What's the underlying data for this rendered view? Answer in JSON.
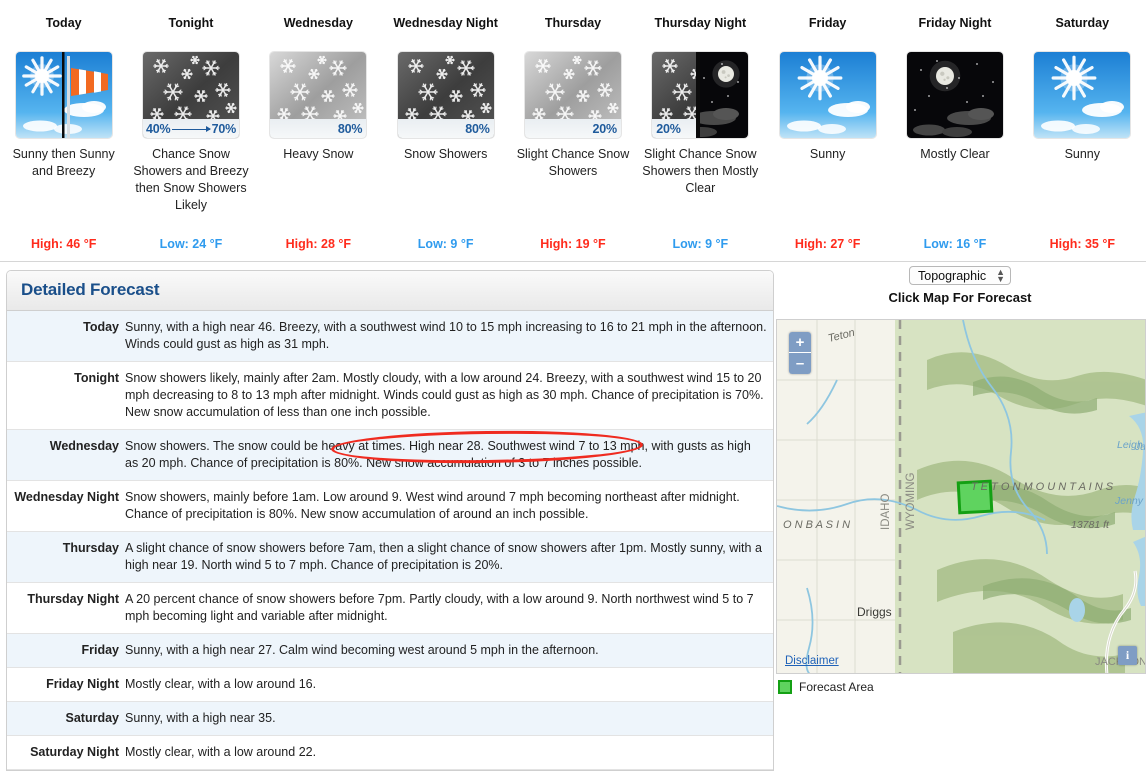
{
  "forecast_periods": [
    {
      "name": "Today",
      "icon": "sunny-windy-icon",
      "short_desc": "Sunny then Sunny and Breezy",
      "temp_type": "High",
      "temp_label": "High: 46 °F",
      "pop": null
    },
    {
      "name": "Tonight",
      "icon": "snow-chance-icon",
      "short_desc": "Chance Snow Showers and Breezy then Snow Showers Likely",
      "temp_type": "Low",
      "temp_label": "Low: 24 °F",
      "pop": "40% ⟶ 70%",
      "pop_start": "40%",
      "pop_end": "70%"
    },
    {
      "name": "Wednesday",
      "icon": "heavy-snow-icon",
      "short_desc": "Heavy Snow",
      "temp_type": "High",
      "temp_label": "High: 28 °F",
      "pop": "80%"
    },
    {
      "name": "Wednesday Night",
      "icon": "snow-showers-icon",
      "short_desc": "Snow Showers",
      "temp_type": "Low",
      "temp_label": "Low: 9 °F",
      "pop": "80%"
    },
    {
      "name": "Thursday",
      "icon": "slight-chance-snow-icon",
      "short_desc": "Slight Chance Snow Showers",
      "temp_type": "High",
      "temp_label": "High: 19 °F",
      "pop": "20%"
    },
    {
      "name": "Thursday Night",
      "icon": "snow-then-clear-night-icon",
      "short_desc": "Slight Chance Snow Showers then Mostly Clear",
      "temp_type": "Low",
      "temp_label": "Low: 9 °F",
      "pop": "20%"
    },
    {
      "name": "Friday",
      "icon": "sunny-icon",
      "short_desc": "Sunny",
      "temp_type": "High",
      "temp_label": "High: 27 °F",
      "pop": null
    },
    {
      "name": "Friday Night",
      "icon": "mostly-clear-night-icon",
      "short_desc": "Mostly Clear",
      "temp_type": "Low",
      "temp_label": "Low: 16 °F",
      "pop": null
    },
    {
      "name": "Saturday",
      "icon": "sunny-icon",
      "short_desc": "Sunny",
      "temp_type": "High",
      "temp_label": "High: 35 °F",
      "pop": null
    }
  ],
  "detailed_forecast": {
    "title": "Detailed Forecast",
    "rows": [
      {
        "label": "Today",
        "text": "Sunny, with a high near 46. Breezy, with a southwest wind 10 to 15 mph increasing to 16 to 21 mph in the afternoon. Winds could gust as high as 31 mph."
      },
      {
        "label": "Tonight",
        "text": "Snow showers likely, mainly after 2am. Mostly cloudy, with a low around 24. Breezy, with a southwest wind 15 to 20 mph decreasing to 8 to 13 mph after midnight. Winds could gust as high as 30 mph. Chance of precipitation is 70%. New snow accumulation of less than one inch possible."
      },
      {
        "label": "Wednesday",
        "text": "Snow showers. The snow could be heavy at times. High near 28. Southwest wind 7 to 13 mph, with gusts as high as 20 mph. Chance of precipitation is 80%. New snow accumulation of 3 to 7 inches possible."
      },
      {
        "label": "Wednesday Night",
        "text": "Snow showers, mainly before 1am. Low around 9. West wind around 7 mph becoming northeast after midnight. Chance of precipitation is 80%. New snow accumulation of around an inch possible."
      },
      {
        "label": "Thursday",
        "text": "A slight chance of snow showers before 7am, then a slight chance of snow showers after 1pm. Mostly sunny, with a high near 19. North wind 5 to 7 mph. Chance of precipitation is 20%."
      },
      {
        "label": "Thursday Night",
        "text": "A 20 percent chance of snow showers before 7pm. Partly cloudy, with a low around 9. North northwest wind 5 to 7 mph becoming light and variable after midnight."
      },
      {
        "label": "Friday",
        "text": "Sunny, with a high near 27. Calm wind becoming west around 5 mph in the afternoon."
      },
      {
        "label": "Friday Night",
        "text": "Mostly clear, with a low around 16."
      },
      {
        "label": "Saturday",
        "text": "Sunny, with a high near 35."
      },
      {
        "label": "Saturday Night",
        "text": "Mostly clear, with a low around 22."
      }
    ]
  },
  "map_panel": {
    "map_type_selected": "Topographic",
    "map_type_options": [
      "Topographic"
    ],
    "click_map_label": "Click Map For Forecast",
    "zoom_in_label": "+",
    "zoom_out_label": "–",
    "disclaimer_label": "Disclaimer",
    "info_label": "i",
    "legend_label": "Forecast Area",
    "labels": {
      "teton_mountains": "T E T O N   M O U N T A I N S",
      "teton_basin": "O N   B A S I N",
      "teton_river": "Teton",
      "idaho": "IDAHO",
      "wyoming": "WYOMING",
      "driggs": "Driggs",
      "leigh_lake": "Leigh Lake",
      "jenny_lake": "Jenny Lake",
      "jackson_lake": "Ja",
      "jackson": "JACKSON",
      "elevation": "13781 ft"
    }
  },
  "colors": {
    "high_temp": "#ff2b1c",
    "low_temp": "#2f9bee",
    "header_blue": "#1a4f8a",
    "pop_blue": "#1f5b9c",
    "annotation_red": "#ef2b20",
    "forecast_area_green": "#5fd35f"
  }
}
